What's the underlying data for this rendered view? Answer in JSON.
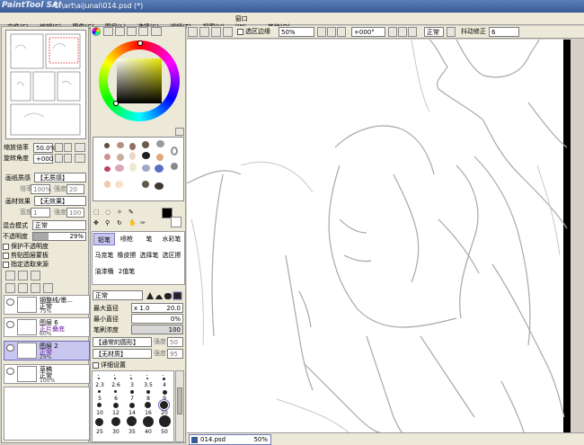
{
  "title": {
    "logo": "PaintTool SAI",
    "path": "C:\\art\\aijunai\\014.psd (*)"
  },
  "menu": [
    "文件(F)",
    "编辑(E)",
    "图像(C)",
    "图层(L)",
    "选择(S)",
    "滤镜(T)",
    "视图(V)",
    "窗口(W)",
    "其他(O)"
  ],
  "navigator": {
    "zoom_label": "缩放倍率",
    "zoom_value": "50.0%",
    "angle_label": "旋转角度",
    "angle_value": "+000"
  },
  "paper": {
    "texture_label": "画纸质感",
    "texture_value": "【无质感】",
    "scale_label": "倍率",
    "scale_value": "100%",
    "strength_label": "强度",
    "strength_value": "20"
  },
  "effect": {
    "label": "画材效果",
    "value": "【无效果】",
    "width_label": "宽度",
    "width_value": "1",
    "strength_label": "强度",
    "strength_value": "100"
  },
  "blend": {
    "mode_label": "混合模式",
    "mode_value": "正常",
    "opacity_label": "不透明度",
    "opacity_value": "29%"
  },
  "options": [
    "保护不透明度",
    "剪贴图层蒙板",
    "指定选取来源"
  ],
  "layers": [
    {
      "name": "钢整线/墨...",
      "mode": "正常",
      "opacity": "75%"
    },
    {
      "name": "图层 6",
      "mode": "正片叠底",
      "opacity": "60%"
    },
    {
      "name": "图层 2",
      "mode": "正常",
      "opacity": "29%"
    },
    {
      "name": "草稿",
      "mode": "正常",
      "opacity": "100%"
    }
  ],
  "tools": [
    "铅笔",
    "喷枪",
    "笔",
    "水彩笔",
    "马克笔",
    "橡皮擦",
    "选择笔",
    "选区擦",
    "油漆桶",
    "2值笔"
  ],
  "brush": {
    "mode": "正常",
    "max_size_label": "最大直径",
    "max_size_mult": "x 1.0",
    "max_size_value": "20.0",
    "min_size_label": "最小直径",
    "min_size_value": "0%",
    "density_label": "笔刷浓度",
    "density_value": "100",
    "shape": "【通常的圆形】",
    "shape_strength_label": "强度",
    "shape_strength_value": "50",
    "texture": "【无材质】",
    "texture_strength_label": "强度",
    "texture_strength_value": "95",
    "detail_label": "详细设置",
    "sizes": [
      [
        "2.3",
        "2.6",
        "3",
        "3.5",
        "4"
      ],
      [
        "5",
        "6",
        "7",
        "8",
        "9"
      ],
      [
        "10",
        "12",
        "14",
        "16",
        "20"
      ],
      [
        "25",
        "30",
        "35",
        "40",
        "50"
      ]
    ]
  },
  "toolbar": {
    "selection_edge_label": "选区边缘",
    "zoom": "50%",
    "angle": "+000°",
    "mode": "正常",
    "stabilizer_label": "抖动修正",
    "stabilizer_value": "6"
  },
  "status": {
    "file": "014.psd",
    "zoom": "50%"
  }
}
